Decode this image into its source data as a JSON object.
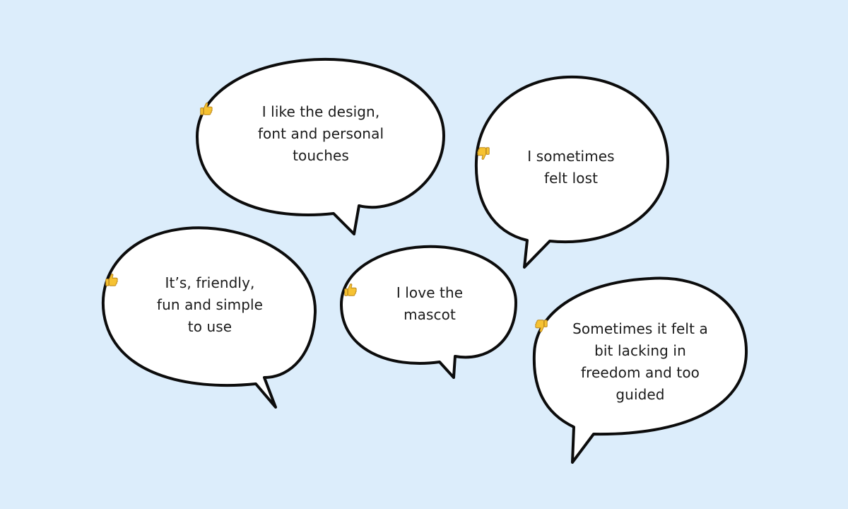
{
  "background_color": "#dcedfb",
  "bubbles": [
    {
      "lines": [
        "I like the design,",
        "font and personal",
        "touches"
      ],
      "reaction_icon": "thumbs-up-icon"
    },
    {
      "lines": [
        "I sometimes",
        "felt lost"
      ],
      "reaction_icon": "thumbs-down-icon"
    },
    {
      "lines": [
        "It’s, friendly,",
        "fun and simple",
        "to use"
      ],
      "reaction_icon": "thumbs-up-icon"
    },
    {
      "lines": [
        "I love the",
        "mascot"
      ],
      "reaction_icon": "thumbs-up-icon"
    },
    {
      "lines": [
        "Sometimes it felt a",
        "bit lacking in",
        "freedom and too",
        "guided"
      ],
      "reaction_icon": "thumbs-down-icon"
    }
  ]
}
